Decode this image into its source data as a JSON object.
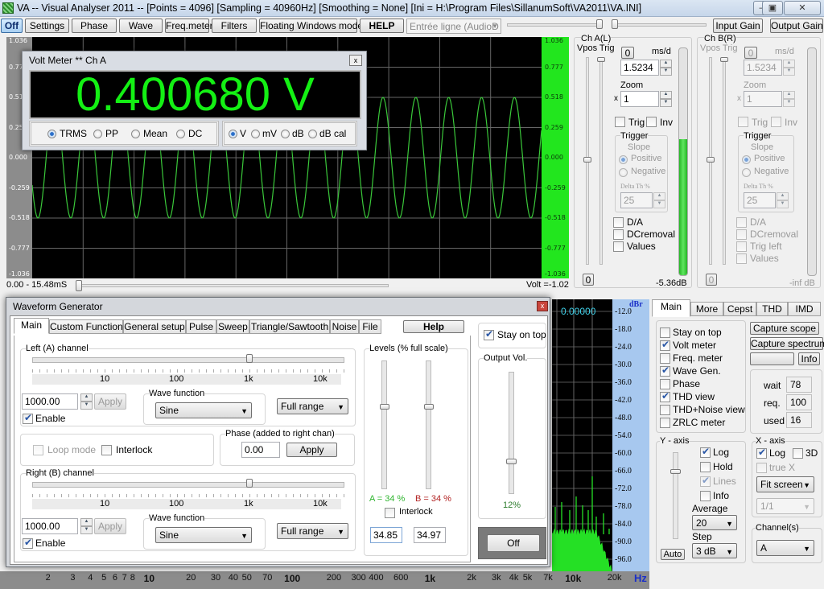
{
  "window": {
    "title": "VA -- Visual Analyser 2011 --  [Points = 4096]  [Sampling = 40960Hz]  [Smoothing = None]  [Ini = H:\\Program Files\\SillanumSoft\\VA2011\\VA.INI]",
    "minimize": "—",
    "restore": "▣",
    "close": "✕"
  },
  "toolbar": {
    "off": "Off",
    "settings": "Settings",
    "phase": "Phase",
    "wave": "Wave",
    "freq_meter": "Freq.meter",
    "filters": "Filters",
    "floating": "Floating Windows mode",
    "help": "HELP",
    "input_device": "Entrée ligne (AudioD",
    "input_gain": "Input Gain",
    "output_gain": "Output Gain"
  },
  "scope": {
    "y_ticks": [
      "1.036",
      "0.777",
      "0.518",
      "0.259",
      "0.000",
      "-0.259",
      "-0.518",
      "-0.777",
      "-1.036"
    ],
    "time_range": "0.00 - 15.48mS",
    "volt_readout": "Volt =-1.02",
    "signal_amplitude": 0.518,
    "cycles_visible": 15.5
  },
  "volt_meter": {
    "title": "Volt Meter ** Ch A",
    "close": "x",
    "value": "0.400680 V",
    "modes": [
      {
        "label": "TRMS",
        "selected": true
      },
      {
        "label": "PP",
        "selected": false
      },
      {
        "label": "Mean",
        "selected": false
      },
      {
        "label": "DC",
        "selected": false
      }
    ],
    "units": [
      {
        "label": "V",
        "selected": true
      },
      {
        "label": "mV",
        "selected": false
      },
      {
        "label": "dB",
        "selected": false
      },
      {
        "label": "dB cal",
        "selected": false
      }
    ]
  },
  "channel_a": {
    "title": "Ch A(L)",
    "vpos_trig": "Vpos Trig",
    "zero_btn": "0",
    "ms_per_div_label": "ms/d",
    "ms_per_div": "1.5234",
    "zoom_label": "Zoom",
    "zoom_x": "x",
    "zoom": "1",
    "trig": "Trig",
    "inv": "Inv",
    "trigger_group": "Trigger",
    "slope": "Slope",
    "positive": "Positive",
    "negative": "Negative",
    "delta_th": "Delta Th %",
    "delta_value": "25",
    "da": "D/A",
    "dcremoval": "DCremoval",
    "values": "Values",
    "bottom_zero": "0",
    "level": "-5.36dB",
    "level_fraction": 0.6
  },
  "channel_b": {
    "title": "Ch B(R)",
    "vpos_trig": "Vpos Trig",
    "zero_btn": "0",
    "ms_per_div_label": "ms/d",
    "ms_per_div": "1.5234",
    "zoom_label": "Zoom",
    "zoom_x": "x",
    "zoom": "1",
    "trig": "Trig",
    "inv": "Inv",
    "trigger_group": "Trigger",
    "slope": "Slope",
    "positive": "Positive",
    "negative": "Negative",
    "delta_th": "Delta Th %",
    "delta_value": "25",
    "da": "D/A",
    "dcremoval": "DCremoval",
    "trig_left": "Trig left",
    "values": "Values",
    "bottom_zero": "0",
    "level": "-inf dB"
  },
  "wavegen": {
    "title": "Waveform Generator",
    "close": "x",
    "tabs": [
      "Main",
      "Custom Function",
      "General setup",
      "Pulse",
      "Sweep",
      "Triangle/Sawtooth",
      "Noise",
      "File"
    ],
    "help": "Help",
    "left": {
      "title": "Left (A) channel",
      "scale": [
        "10",
        "100",
        "1k",
        "10k"
      ],
      "freq": "1000.00",
      "apply": "Apply",
      "enable": "Enable",
      "wave_function_label": "Wave function",
      "wave_function": "Sine",
      "range": "Full range"
    },
    "loop_mode": "Loop mode",
    "interlock": "Interlock",
    "phase": {
      "title": "Phase (added to right chan)",
      "value": "0.00",
      "apply": "Apply"
    },
    "right": {
      "title": "Right (B) channel",
      "scale": [
        "10",
        "100",
        "1k",
        "10k"
      ],
      "freq": "1000.00",
      "apply": "Apply",
      "enable": "Enable",
      "wave_function_label": "Wave function",
      "wave_function": "Sine",
      "range": "Full range"
    },
    "levels": {
      "title": "Levels (% full scale)",
      "a_label": "A = 34 %",
      "b_label": "B = 34 %",
      "interlock": "Interlock",
      "a_value": "34.85",
      "b_value": "34.97",
      "a_fraction": 0.35,
      "b_fraction": 0.35
    },
    "stay_on_top": "Stay on top",
    "output_vol": {
      "title": "Output Vol.",
      "value": "12%",
      "fraction": 0.12
    },
    "off": "Off"
  },
  "spectrum": {
    "readout": "0.00000",
    "y_unit": "dBr",
    "y_ticks": [
      "-12.0",
      "-18.0",
      "-24.0",
      "-30.0",
      "-36.0",
      "-42.0",
      "-48.0",
      "-54.0",
      "-60.0",
      "-66.0",
      "-72.0",
      "-78.0",
      "-84.0",
      "-90.0",
      "-96.0"
    ],
    "x_ticks": [
      {
        "l": "2",
        "f": 2
      },
      {
        "l": "3",
        "f": 3
      },
      {
        "l": "4",
        "f": 4
      },
      {
        "l": "5",
        "f": 5
      },
      {
        "l": "6",
        "f": 6
      },
      {
        "l": "7",
        "f": 7
      },
      {
        "l": "8",
        "f": 8
      },
      {
        "l": "10",
        "f": 10,
        "b": true
      },
      {
        "l": "20",
        "f": 20
      },
      {
        "l": "30",
        "f": 30
      },
      {
        "l": "40",
        "f": 40
      },
      {
        "l": "50",
        "f": 50
      },
      {
        "l": "70",
        "f": 70
      },
      {
        "l": "100",
        "f": 100,
        "b": true
      },
      {
        "l": "200",
        "f": 200
      },
      {
        "l": "300",
        "f": 300
      },
      {
        "l": "400",
        "f": 400
      },
      {
        "l": "600",
        "f": 600
      },
      {
        "l": "1k",
        "f": 1000,
        "b": true
      },
      {
        "l": "2k",
        "f": 2000
      },
      {
        "l": "3k",
        "f": 3000
      },
      {
        "l": "4k",
        "f": 4000
      },
      {
        "l": "5k",
        "f": 5000
      },
      {
        "l": "7k",
        "f": 7000
      },
      {
        "l": "10k",
        "f": 10000,
        "b": true
      },
      {
        "l": "20k",
        "f": 20000
      }
    ],
    "x_unit": "Hz"
  },
  "right_panel": {
    "tabs": [
      "Main",
      "More",
      "Cepst",
      "THD",
      "IMD"
    ],
    "checks": [
      {
        "label": "Stay on top",
        "checked": false
      },
      {
        "label": "Volt meter",
        "checked": true
      },
      {
        "label": "Freq. meter",
        "checked": false
      },
      {
        "label": "Wave Gen.",
        "checked": true
      },
      {
        "label": "Phase",
        "checked": false
      },
      {
        "label": "THD view",
        "checked": true
      },
      {
        "label": "THD+Noise view",
        "checked": false
      },
      {
        "label": "ZRLC meter",
        "checked": false
      }
    ],
    "capture_scope": "Capture scope",
    "capture_spectrum": "Capture spectrum",
    "info": "Info",
    "wait_label": "wait",
    "wait": "78",
    "req_label": "req.",
    "req": "100",
    "used_label": "used",
    "used": "16",
    "y_axis": {
      "title": "Y - axis",
      "log": "Log",
      "log_checked": true,
      "hold": "Hold",
      "hold_checked": false,
      "lines": "Lines",
      "lines_checked": true,
      "info": "Info",
      "info_checked": false,
      "average_label": "Average",
      "average": "20",
      "step_label": "Step",
      "step": "3 dB",
      "auto": "Auto"
    },
    "x_axis": {
      "title": "X - axis",
      "log": "Log",
      "log_checked": true,
      "three_d": "3D",
      "three_d_checked": false,
      "true_x": "true X",
      "fit": "Fit screen",
      "ratio": "1/1"
    },
    "channels": {
      "title": "Channel(s)",
      "value": "A"
    }
  }
}
